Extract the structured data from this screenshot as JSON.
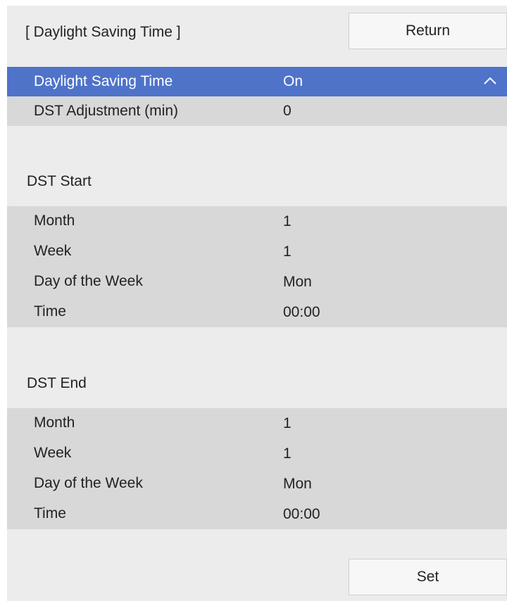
{
  "header": {
    "title": "[ Daylight Saving Time ]",
    "return_label": "Return"
  },
  "settings": {
    "dst": {
      "label": "Daylight Saving Time",
      "value": "On"
    },
    "adjustment": {
      "label": "DST Adjustment (min)",
      "value": "0"
    }
  },
  "dst_start": {
    "title": "DST Start",
    "rows": [
      {
        "label": "Month",
        "value": "1"
      },
      {
        "label": "Week",
        "value": "1"
      },
      {
        "label": "Day of the Week",
        "value": "Mon"
      },
      {
        "label": "Time",
        "value": "00:00"
      }
    ]
  },
  "dst_end": {
    "title": "DST End",
    "rows": [
      {
        "label": "Month",
        "value": "1"
      },
      {
        "label": "Week",
        "value": "1"
      },
      {
        "label": "Day of the Week",
        "value": "Mon"
      },
      {
        "label": "Time",
        "value": "00:00"
      }
    ]
  },
  "footer": {
    "set_label": "Set"
  },
  "colors": {
    "selected": "#4f73c9",
    "panel": "#ececec",
    "row": "#d8d8d8"
  }
}
